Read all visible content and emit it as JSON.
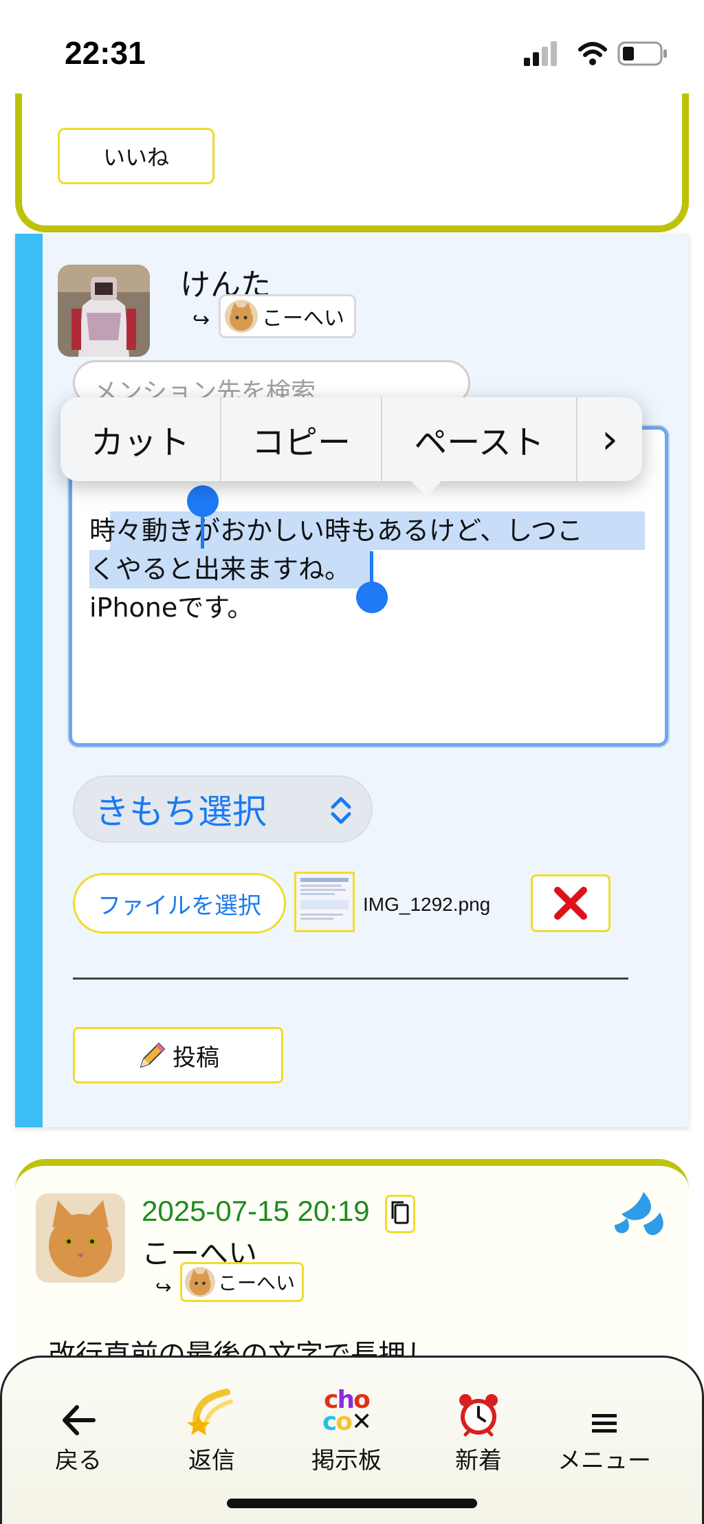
{
  "status_bar": {
    "time": "22:31"
  },
  "previous_post": {
    "like_label": "いいね"
  },
  "reply_form": {
    "author_name": "けんた",
    "reply_arrow": "↪",
    "mention_chip_name": "こーへい",
    "mention_search_placeholder": "メンション先を検索",
    "text": {
      "line1_before": "時々動き",
      "line1_selected": "がおかしい時もあるけど、しつこ",
      "line2_selected": "くやると出来ますね。",
      "line3": "iPhoneです。"
    },
    "mood_select_label": "きもち選択",
    "file_button_label": "ファイルを選択",
    "file_name": "IMG_1292.png",
    "post_button_label": "投稿",
    "post_button_icon": "pencil-icon"
  },
  "edit_menu": {
    "items": [
      "カット",
      "コピー",
      "ペースト",
      "›"
    ]
  },
  "next_post": {
    "date": "2025-07-15 20:19",
    "author": "こーへい",
    "reply_arrow": "↪",
    "reply_to": "こーへい",
    "body": "改行直前の最後の文字で長押し"
  },
  "bottom_nav": {
    "items": [
      {
        "label": "戻る",
        "icon": "back-arrow-icon"
      },
      {
        "label": "返信",
        "icon": "shooting-star-icon"
      },
      {
        "label": "掲示板",
        "icon": "choco-logo-icon",
        "logo_text_top": "cho",
        "logo_text_bottom": "co"
      },
      {
        "label": "新着",
        "icon": "alarm-clock-icon"
      },
      {
        "label": "メニュー",
        "icon": "hamburger-icon"
      }
    ]
  },
  "colors": {
    "accent_yellow": "#f0dc2c",
    "card_border_olive": "#bfc20a",
    "reply_side_bar": "#3dbdf5",
    "link_blue": "#1a7af0",
    "date_green": "#1f8a1f",
    "selection": "#c7ddf8"
  }
}
